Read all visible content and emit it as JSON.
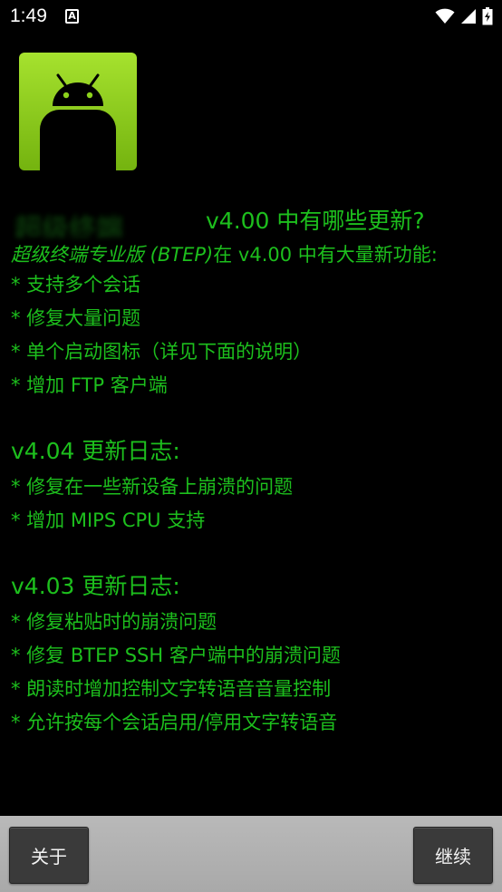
{
  "status_bar": {
    "time": "1:49",
    "notification_letter": "A",
    "icons": [
      "wifi-icon",
      "signal-icon",
      "battery-icon"
    ]
  },
  "app_icon": {
    "name": "android-icon",
    "background": "#8cd21c"
  },
  "ghost_text": "超级终端",
  "changelog": {
    "heading": "v4.00 中有哪些更新?",
    "intro_em": "超级终端专业版 (BTEP)",
    "intro_rest": "在 v4.00 中有大量新功能:",
    "v400_items": [
      "* 支持多个会话",
      "* 修复大量问题",
      "* 单个启动图标（详见下面的说明）",
      "* 增加 FTP 客户端"
    ],
    "v404_title": "v4.04 更新日志:",
    "v404_items": [
      "* 修复在一些新设备上崩溃的问题",
      "* 增加 MIPS CPU 支持"
    ],
    "v403_title": "v4.03 更新日志:",
    "v403_items": [
      "* 修复粘贴时的崩溃问题",
      "* 修复 BTEP SSH 客户端中的崩溃问题",
      "* 朗读时增加控制文字转语音音量控制",
      "* 允许按每个会话启用/停用文字转语音"
    ]
  },
  "buttons": {
    "about": "关于",
    "continue": "继续"
  },
  "colors": {
    "text_green": "#1dbf1d",
    "background": "#000000",
    "bar": "#b0b0b0"
  }
}
